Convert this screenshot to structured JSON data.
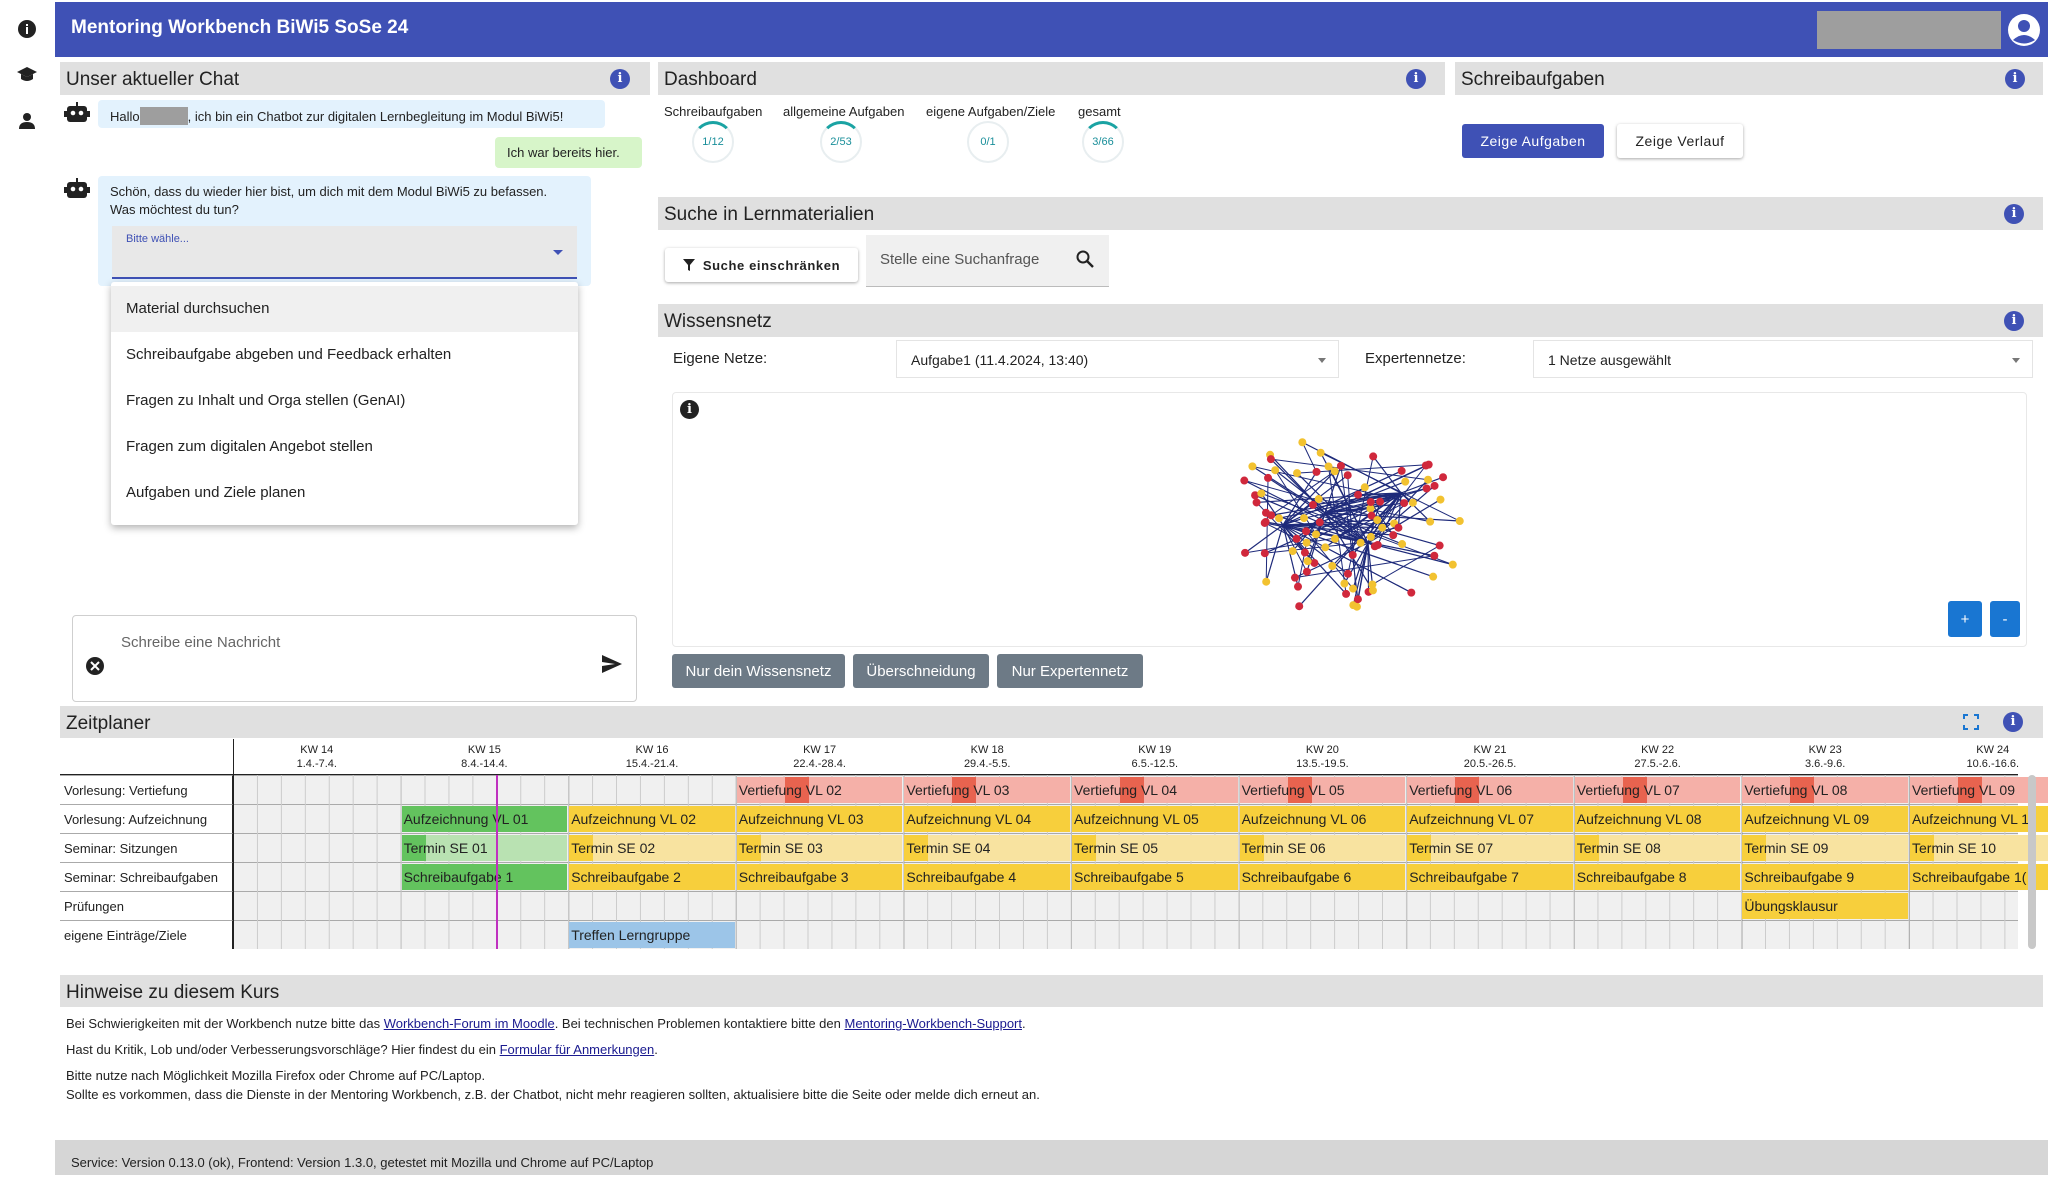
{
  "app": {
    "title": "Mentoring Workbench BiWi5 SoSe 24"
  },
  "rail": {
    "icons": [
      "info-icon",
      "graduation-cap-icon",
      "person-icon"
    ]
  },
  "chat": {
    "title": "Unser aktueller Chat",
    "greeting_prefix": "Hallo",
    "greeting_suffix": ", ich bin ein Chatbot zur digitalen Lernbegleitung im Modul BiWi5!",
    "user_reply": "Ich war bereits hier.",
    "bot_question_line1": "Schön, dass du wieder hier bist, um dich mit dem Modul BiWi5 zu befassen.",
    "bot_question_line2": "Was möchtest du tun?",
    "select_label": "Bitte wähle...",
    "options": [
      "Material durchsuchen",
      "Schreibaufgabe abgeben und Feedback erhalten",
      "Fragen zu Inhalt und Orga stellen (GenAI)",
      "Fragen zum digitalen Angebot stellen",
      "Aufgaben und Ziele planen"
    ],
    "input_placeholder": "Schreibe eine Nachricht"
  },
  "dashboard": {
    "title": "Dashboard",
    "gauges": [
      {
        "label": "Schreibaufgaben",
        "value": "1/12",
        "fraction": 0.083
      },
      {
        "label": "allgemeine Aufgaben",
        "value": "2/53",
        "fraction": 0.038
      },
      {
        "label": "eigene Aufgaben/Ziele",
        "value": "0/1",
        "fraction": 0.0
      },
      {
        "label": "gesamt",
        "value": "3/66",
        "fraction": 0.045
      }
    ]
  },
  "schreibaufgaben": {
    "title": "Schreibaufgaben",
    "show_tasks": "Zeige Aufgaben",
    "show_history": "Zeige Verlauf"
  },
  "search": {
    "title": "Suche in Lernmaterialien",
    "filter_label": "Suche einschränken",
    "placeholder": "Stelle eine Suchanfrage"
  },
  "wissensnetz": {
    "title": "Wissensnetz",
    "own_label": "Eigene Netze:",
    "own_value": "Aufgabe1 (11.4.2024, 13:40)",
    "expert_label": "Expertennetze:",
    "expert_value": "1 Netze ausgewählt",
    "zoom_in": "+",
    "zoom_out": "-",
    "btn_own": "Nur dein Wissensnetz",
    "btn_overlap": "Überschneidung",
    "btn_expert": "Nur Expertennetz",
    "colors": {
      "node_a": "#f2c230",
      "node_b": "#d0283c",
      "edge": "#1e2a7a"
    }
  },
  "zeitplaner": {
    "title": "Zeitplaner",
    "weeks": [
      {
        "kw": "KW 14",
        "range": "1.4.-7.4."
      },
      {
        "kw": "KW 15",
        "range": "8.4.-14.4."
      },
      {
        "kw": "KW 16",
        "range": "15.4.-21.4."
      },
      {
        "kw": "KW 17",
        "range": "22.4.-28.4."
      },
      {
        "kw": "KW 18",
        "range": "29.4.-5.5."
      },
      {
        "kw": "KW 19",
        "range": "6.5.-12.5."
      },
      {
        "kw": "KW 20",
        "range": "13.5.-19.5."
      },
      {
        "kw": "KW 21",
        "range": "20.5.-26.5."
      },
      {
        "kw": "KW 22",
        "range": "27.5.-2.6."
      },
      {
        "kw": "KW 23",
        "range": "3.6.-9.6."
      },
      {
        "kw": "KW 24",
        "range": "10.6.-16.6."
      }
    ],
    "rows": [
      "Vorlesung: Vertiefung",
      "Vorlesung: Aufzeichnung",
      "Seminar: Sitzungen",
      "Seminar: Schreibaufgaben",
      "Prüfungen",
      "eigene Einträge/Ziele"
    ],
    "vertiefung": [
      "Vertiefung VL 02",
      "Vertiefung VL 03",
      "Vertiefung VL 04",
      "Vertiefung VL 05",
      "Vertiefung VL 06",
      "Vertiefung VL 07",
      "Vertiefung VL 08",
      "Vertiefung VL 09"
    ],
    "aufzeichnung": [
      "Aufzeichnung VL 01",
      "Aufzeichnung VL 02",
      "Aufzeichnung VL 03",
      "Aufzeichnung VL 04",
      "Aufzeichnung VL 05",
      "Aufzeichnung VL 06",
      "Aufzeichnung VL 07",
      "Aufzeichnung VL 08",
      "Aufzeichnung VL 09",
      "Aufzeichnung VL 1"
    ],
    "sitzungen": [
      "Termin SE 01",
      "Termin SE 02",
      "Termin SE 03",
      "Termin SE 04",
      "Termin SE 05",
      "Termin SE 06",
      "Termin SE 07",
      "Termin SE 08",
      "Termin SE 09",
      "Termin SE 10"
    ],
    "schreibaufgaben": [
      "Schreibaufgabe 1",
      "Schreibaufgabe 2",
      "Schreibaufgabe 3",
      "Schreibaufgabe 4",
      "Schreibaufgabe 5",
      "Schreibaufgabe 6",
      "Schreibaufgabe 7",
      "Schreibaufgabe 8",
      "Schreibaufgabe 9",
      "Schreibaufgabe 1("
    ],
    "pruefung": "Übungsklausur",
    "eigene": "Treffen Lerngruppe",
    "colors": {
      "yellow": "#f7cf3c",
      "green": "#63c35e",
      "red": "#f5b0a8",
      "redbadge": "#e8634f",
      "blue": "#9cc5e8",
      "lightyellow": "#f8e3a0",
      "lightgreen": "#b9e2b2",
      "today": "#c030c0"
    }
  },
  "hinweise": {
    "title": "Hinweise zu diesem Kurs",
    "l1_a": "Bei Schwierigkeiten mit der Workbench nutze bitte das ",
    "l1_link1": "Workbench-Forum im Moodle",
    "l1_b": ". Bei technischen Problemen kontaktiere bitte den ",
    "l1_link2": "Mentoring-Workbench-Support",
    "l1_c": ".",
    "l2_a": "Hast du Kritik, Lob und/oder Verbesserungsvorschläge? Hier findest du ein ",
    "l2_link": "Formular für Anmerkungen",
    "l2_b": ".",
    "l3": "Bitte nutze nach Möglichkeit Mozilla Firefox oder Chrome auf PC/Laptop.",
    "l4": "Sollte es vorkommen, dass die Dienste in der Mentoring Workbench, z.B. der Chatbot, nicht mehr reagieren sollten, aktualisiere bitte die Seite oder melde dich erneut an."
  },
  "footer": {
    "text": "Service: Version 0.13.0 (ok), Frontend: Version 1.3.0, getestet mit Mozilla und Chrome auf PC/Laptop"
  }
}
